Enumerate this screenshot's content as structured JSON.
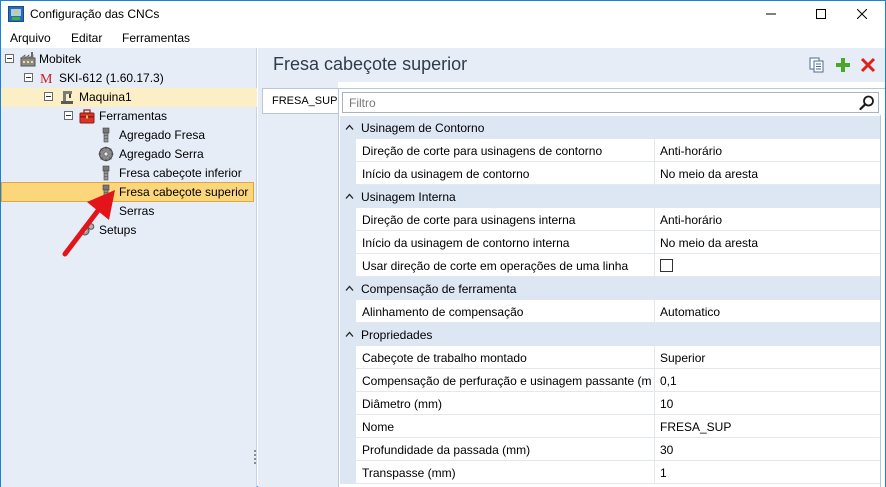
{
  "window": {
    "title": "Configuração das CNCs",
    "controls": [
      "minimize",
      "maximize",
      "close"
    ]
  },
  "menu": [
    "Arquivo",
    "Editar",
    "Ferramentas"
  ],
  "tree": {
    "root": "Mobitek",
    "cnc": "SKI-612 (1.60.17.3)",
    "machine": "Maquina1",
    "tools_folder": "Ferramentas",
    "tools": [
      "Agregado Fresa",
      "Agregado Serra",
      "Fresa cabeçote inferior",
      "Fresa cabeçote superior"
    ],
    "selected_tool": "Fresa cabeçote superior",
    "saws": "Serras",
    "setups": "Setups"
  },
  "panel": {
    "title": "Fresa cabeçote superior",
    "tab": "FRESA_SUP",
    "filter_placeholder": "Filtro"
  },
  "properties": [
    {
      "category": "Usinagem de Contorno",
      "items": [
        {
          "name": "Direção de corte para usinagens de contorno",
          "value": "Anti-horário"
        },
        {
          "name": "Início da usinagem de contorno",
          "value": "No meio da aresta"
        }
      ]
    },
    {
      "category": "Usinagem Interna",
      "items": [
        {
          "name": "Direção de corte para usinagens interna",
          "value": "Anti-horário"
        },
        {
          "name": "Início da usinagem de contorno interna",
          "value": "No meio da aresta"
        },
        {
          "name": "Usar direção de corte em operações de uma linha",
          "value": "",
          "checkbox": true,
          "checked": false
        }
      ]
    },
    {
      "category": "Compensação de ferramenta",
      "items": [
        {
          "name": "Alinhamento de compensação",
          "value": "Automatico"
        }
      ]
    },
    {
      "category": "Propriedades",
      "items": [
        {
          "name": "Cabeçote de trabalho montado",
          "value": "Superior"
        },
        {
          "name": "Compensação de perfuração e usinagem passante (mm)",
          "value": "0,1"
        },
        {
          "name": "Diâmetro (mm)",
          "value": "10"
        },
        {
          "name": "Nome",
          "value": "FRESA_SUP"
        },
        {
          "name": "Profundidade da passada (mm)",
          "value": "30"
        },
        {
          "name": "Transpasse (mm)",
          "value": "1"
        }
      ]
    }
  ],
  "colors": {
    "panel_bg": "#e6edf7",
    "category_bg": "#dde6f3",
    "selection": "#fcd67a",
    "selection_border": "#e2a640",
    "window_border": "#1883d7",
    "add_icon": "#4aa829",
    "delete_icon": "#e0201b",
    "arrow": "#e3151a"
  }
}
